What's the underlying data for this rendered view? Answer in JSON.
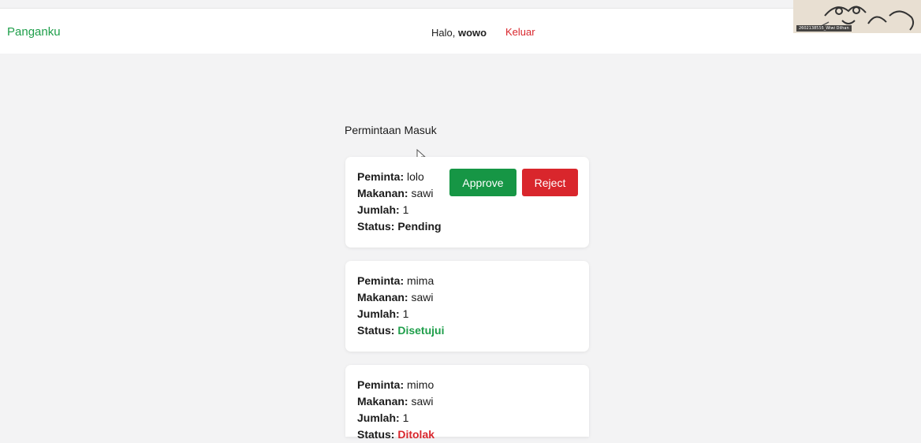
{
  "navbar": {
    "brand": "Panganku",
    "greeting_prefix": "Halo, ",
    "username": "wowo",
    "logout_label": "Keluar"
  },
  "webcam": {
    "caption": "2602138555_Wiwi Dilhan"
  },
  "section": {
    "title": "Permintaan Masuk"
  },
  "labels": {
    "requester": "Peminta:",
    "food": "Makanan:",
    "quantity": "Jumlah:",
    "status": "Status:"
  },
  "requests": [
    {
      "requester": "lolo",
      "food": "sawi",
      "quantity": "1",
      "status": "Pending",
      "approve_label": "Approve",
      "reject_label": "Reject"
    },
    {
      "requester": "mima",
      "food": "sawi",
      "quantity": "1",
      "status": "Disetujui"
    },
    {
      "requester": "mimo",
      "food": "sawi",
      "quantity": "1",
      "status": "Ditolak"
    }
  ],
  "colors": {
    "brand": "#1e9e4a",
    "approved": "#1e9e4a",
    "rejected": "#d9262c",
    "approve_button": "#169645",
    "reject_button": "#d9262c"
  }
}
